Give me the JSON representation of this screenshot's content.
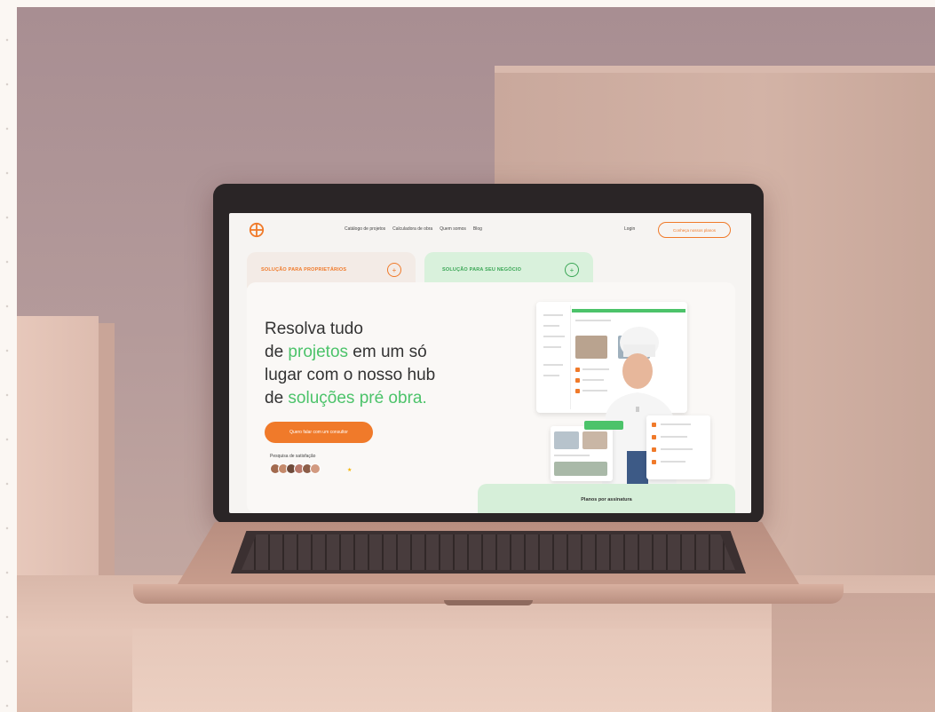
{
  "nav": {
    "links": [
      "Catálogo de projetos",
      "Calculadora de obra",
      "Quem somos",
      "Blog"
    ],
    "login": "Login",
    "cta": "Conheça nossos planos"
  },
  "tabs": [
    {
      "label": "SOLUÇÃO PARA PROPRIETÁRIOS",
      "icon": "plus-icon"
    },
    {
      "label": "SOLUÇÃO PARA SEU NEGÓCIO",
      "icon": "plus-icon"
    }
  ],
  "hero": {
    "line1": "Resolva tudo",
    "line2_pre": "de ",
    "line2_green": "projetos",
    "line2_post": " em um só",
    "line3": "lugar com o nosso hub",
    "line4_pre": "de ",
    "line4_green": "soluções pré obra.",
    "cta": "Quero falar com um consultor",
    "rating_label": "Pesquisa de satisfação"
  },
  "plans": {
    "label": "Planos por assinatura"
  },
  "colors": {
    "accent_orange": "#f07a2a",
    "accent_green": "#4cc36a"
  }
}
